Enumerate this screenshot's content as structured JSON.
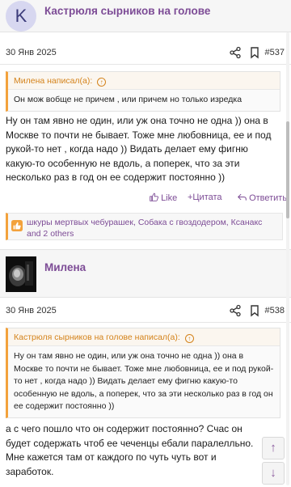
{
  "post1": {
    "avatar_letter": "K",
    "author": "Кастрюля сырников на голове",
    "date": "30 Янв 2025",
    "number": "#537",
    "quote": {
      "author_line": "Милена написал(а):",
      "text": "Он мож вобще не причем , или причем но только изредка"
    },
    "message": "Ну он там явно не один, или уж она точно не одна )) она в Москве то почти не бывает. Тоже мне любовница, ее и под рукой-то нет , когда надо )) Видать делает ему фигню какую-то особенную не вдоль, а поперек, что за эти несколько раз в год он ее содержит постоянно ))",
    "actions": {
      "like": "Like",
      "quote": "+Цитата",
      "reply": "Ответить"
    },
    "likes": "шкуры мертвых чебурашек, Собака с гвоздодером, Ксанакс and 2 others"
  },
  "post2": {
    "author": "Милена",
    "date": "30 Янв 2025",
    "number": "#538",
    "quote": {
      "author_line": "Кастрюля сырников на голове написал(а):",
      "text": "Ну он там явно не один, или уж она точно не одна )) она в Москве то почти не бывает. Тоже мне любовница, ее и под рукой-то нет , когда надо )) Видать делает ему фигню какую-то особенную не вдоль, а поперек, что за эти несколько раз в год он ее содержит постоянно ))"
    },
    "message": "а с чего пошло что он содержит постоянно? Счас он будет содержать чтоб ее чеченцы ебали паралелльно. Мне кажется там от каждого по чуть чуть вот и заработок."
  },
  "icons": {
    "share": "share-icon",
    "bookmark": "bookmark-icon",
    "like": "thumbs-up-icon",
    "quote_up": "arrow-up-circle-icon",
    "reply": "reply-icon",
    "likes_badge": "thumbs-up-badge-icon",
    "scroll_up": "arrow-up-icon",
    "scroll_down": "arrow-down-icon"
  },
  "colors": {
    "accent": "#7d4c96",
    "quote_accent": "#f3a23c"
  }
}
